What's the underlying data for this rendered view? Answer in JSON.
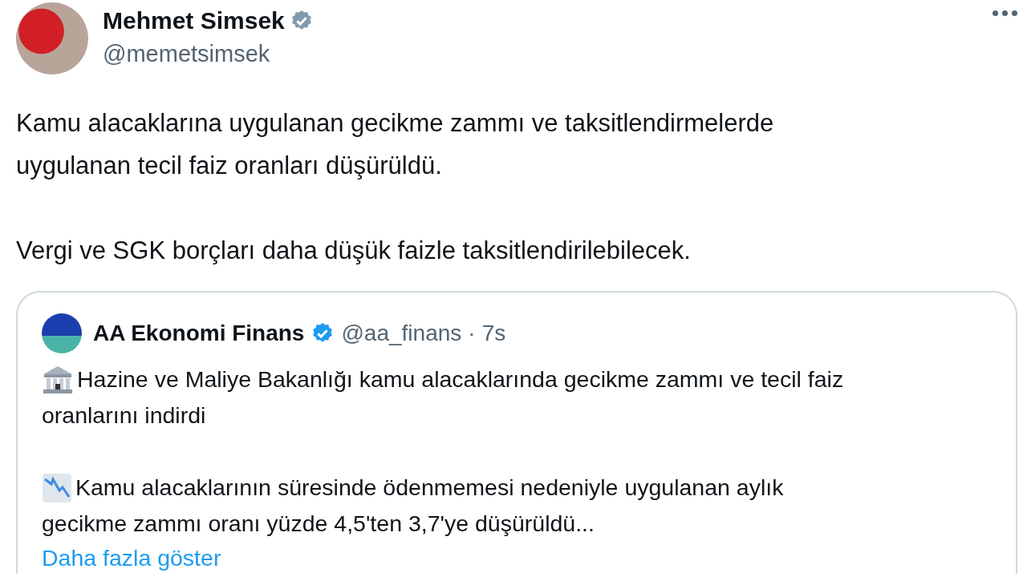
{
  "author": {
    "name": "Mehmet Simsek",
    "handle": "@memetsimsek"
  },
  "text_paragraphs": [
    [
      "Kamu alacaklarına uygulanan gecikme zammı ve taksitlendirmelerde",
      "uygulanan tecil faiz oranları düşürüldü."
    ],
    [
      "Vergi ve SGK borçları daha düşük faizle taksitlendirilebilecek."
    ]
  ],
  "quoted_post": {
    "author": "AA Ekonomi Finans",
    "handle": "@aa_finans",
    "separator": "·",
    "time": "7s",
    "paragraphs": [
      {
        "lines": [
          "Hazine ve Maliye Bakanlığı kamu alacaklarında gecikme zammı ve tecil faiz",
          "oranlarını indirdi"
        ]
      },
      {
        "lines": [
          "Kamu alacaklarının süresinde ödenmemesi nedeniyle uygulanan aylık",
          "gecikme zammı oranı yüzde 4,5'ten 3,7'ye düşürüldü..."
        ]
      }
    ],
    "show_more": "Daha fazla göster"
  }
}
